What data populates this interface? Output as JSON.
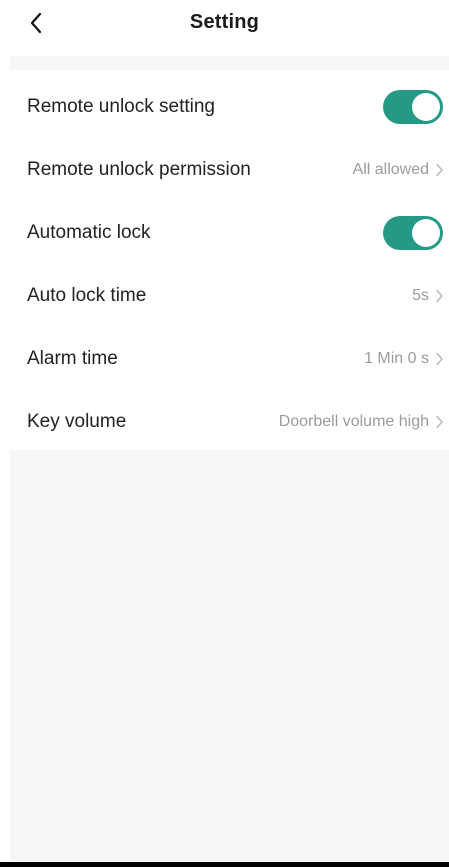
{
  "header": {
    "title": "Setting",
    "back_icon": "chevron-left-icon"
  },
  "colors": {
    "accent": "#249a86",
    "value_text": "#9b9b9b",
    "label_text": "#222222",
    "section_bg": "#f6f6f6"
  },
  "settings": {
    "remote_unlock_setting": {
      "label": "Remote unlock setting",
      "enabled": true
    },
    "remote_unlock_permission": {
      "label": "Remote unlock permission",
      "value": "All allowed"
    },
    "automatic_lock": {
      "label": "Automatic lock",
      "enabled": true
    },
    "auto_lock_time": {
      "label": "Auto lock time",
      "value": "5s"
    },
    "alarm_time": {
      "label": "Alarm time",
      "value": "1 Min 0 s"
    },
    "key_volume": {
      "label": "Key volume",
      "value": "Doorbell volume high"
    }
  }
}
